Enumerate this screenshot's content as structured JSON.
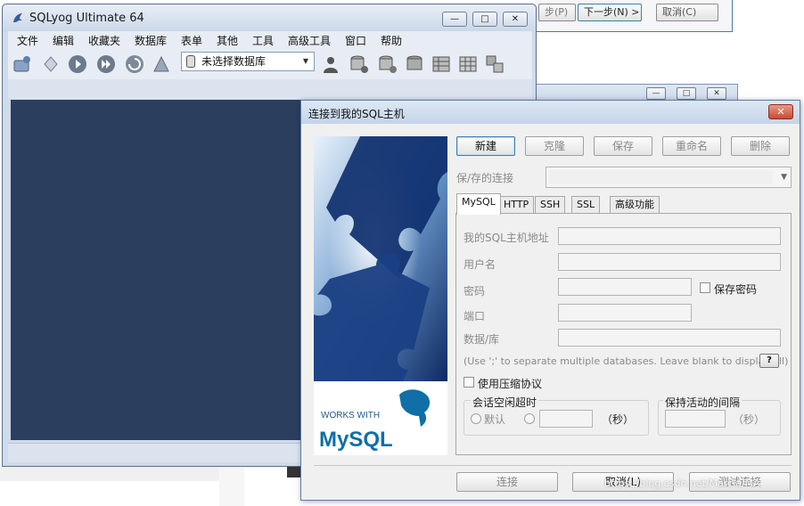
{
  "background": {
    "wizard": {
      "prev_label": "步(P)",
      "next_label": "下一步(N) >",
      "cancel_label": "取消(C)"
    },
    "window2_title": "",
    "fragment": "—"
  },
  "main_window": {
    "title": "SQLyog Ultimate 64",
    "menu": [
      "文件",
      "编辑",
      "收藏夹",
      "数据库",
      "表单",
      "其他",
      "工具",
      "高级工具",
      "窗口",
      "帮助"
    ],
    "db_select": "未选择数据库",
    "caption_buttons": {
      "minimize": "—",
      "maximize": "□",
      "close": "✕"
    }
  },
  "dialog": {
    "title": "连接到我的SQL主机",
    "close_label": "✕",
    "top_buttons": {
      "new": "新建",
      "clone": "克隆",
      "save": "保存",
      "rename": "重命名",
      "delete": "删除"
    },
    "saved_connection_label": "保/存的连接",
    "tabs": [
      "MySQL",
      "HTTP",
      "SSH",
      "SSL",
      "高级功能"
    ],
    "active_tab": "MySQL",
    "fields": {
      "host_label": "我的SQL主机地址",
      "user_label": "用户名",
      "password_label": "密码",
      "save_password_label": "保存密码",
      "port_label": "端口",
      "database_label": "数据/库",
      "database_hint": "(Use ';' to separate multiple databases. Leave blank to display all)",
      "help_label": "?"
    },
    "compression_label": "使用压缩协议",
    "session_timeout": {
      "title": "会话空闲超时",
      "default_label": "默认",
      "unit": "（秒）"
    },
    "keepalive": {
      "title": "保持活动的间隔",
      "unit": "（秒）"
    },
    "bottom_buttons": {
      "connect": "连接",
      "cancel": "取消(L)",
      "test": "测试连接"
    },
    "brand": {
      "works_with": "WORKS WITH",
      "mysql": "MySQL"
    }
  },
  "watermark": "https://blog.csdn.net/Marcia/MA"
}
